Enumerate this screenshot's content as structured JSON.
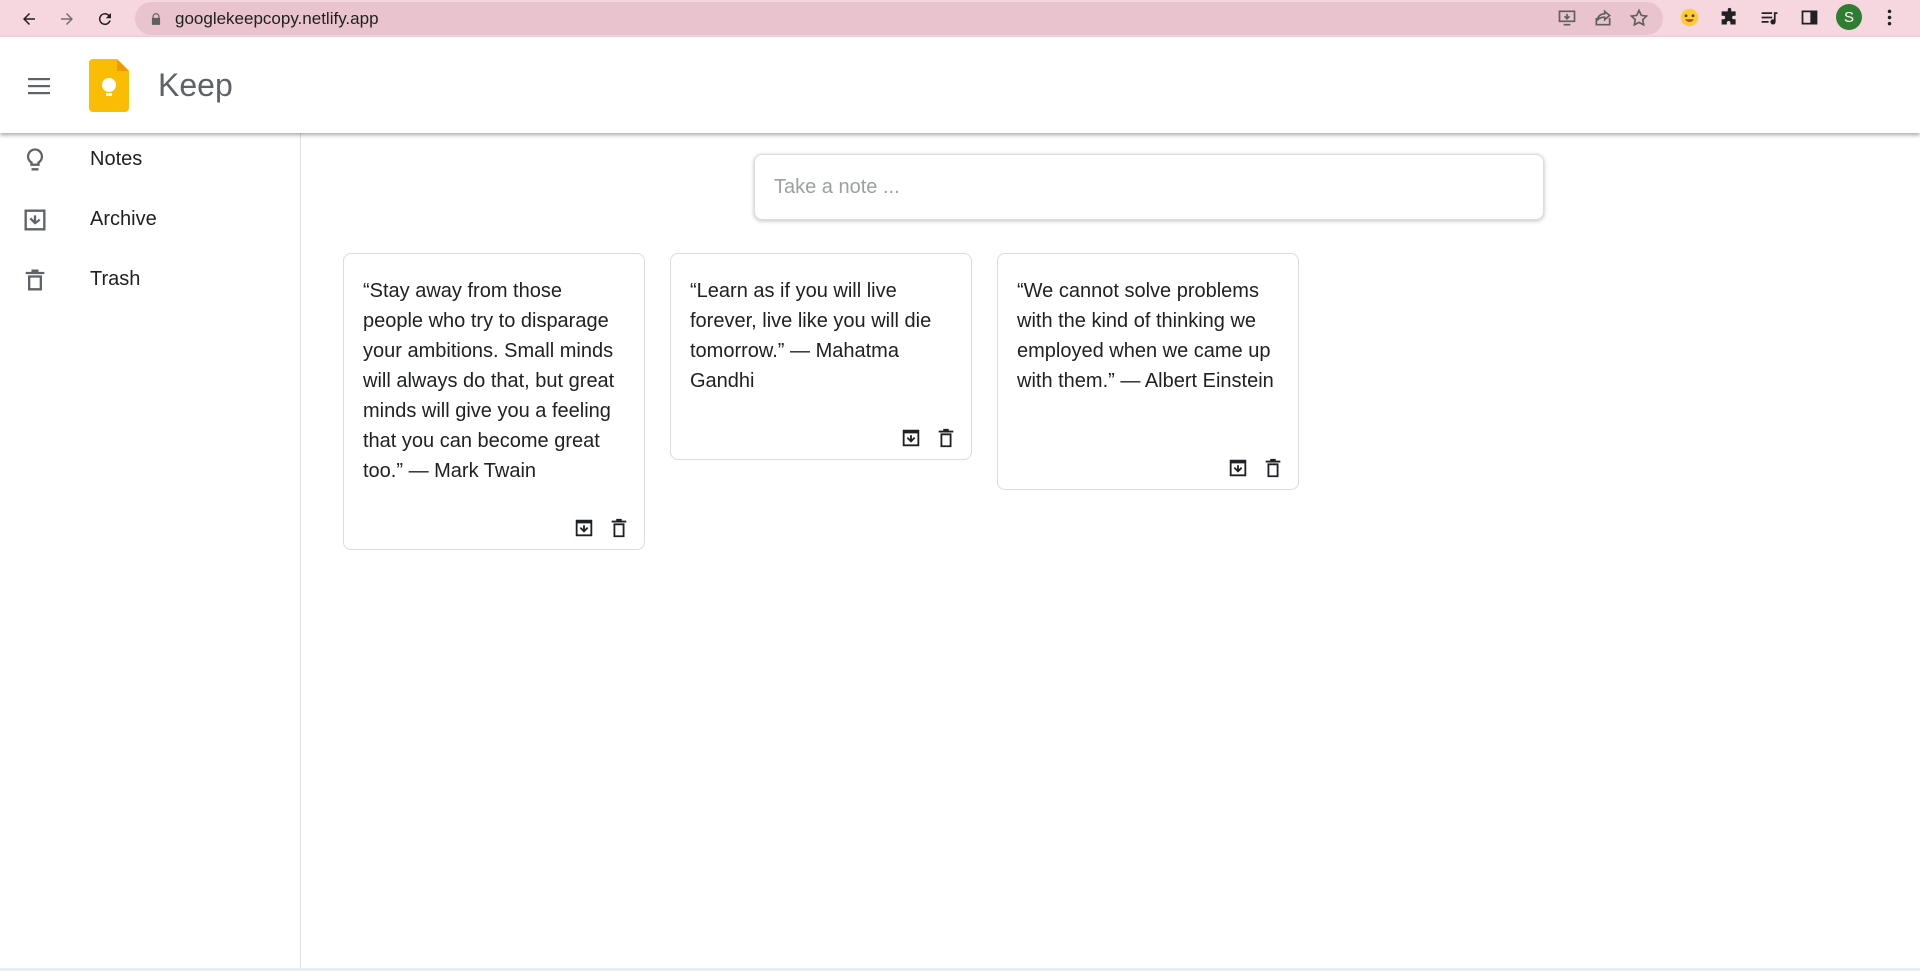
{
  "browser": {
    "url": "googlekeepcopy.netlify.app",
    "profile_initial": "S",
    "profile_color": "#2e7d32"
  },
  "header": {
    "title": "Keep",
    "logo_color": "#fbbc04"
  },
  "sidebar": {
    "items": [
      {
        "label": "Notes",
        "icon": "lightbulb-icon"
      },
      {
        "label": "Archive",
        "icon": "archive-icon"
      },
      {
        "label": "Trash",
        "icon": "trash-icon"
      }
    ]
  },
  "composer": {
    "placeholder": "Take a note ..."
  },
  "notes": [
    {
      "text": "“Stay away from those people who try to disparage your ambitions. Small minds will always do that, but great minds will give you a feeling that you can become great too.” — Mark Twain"
    },
    {
      "text": "“Learn as if you will live forever, live like you will die tomorrow.” — Mahatma Gandhi"
    },
    {
      "text": "“We cannot solve problems with the kind of thinking we employed when we came up with them.” — Albert Einstein"
    }
  ]
}
